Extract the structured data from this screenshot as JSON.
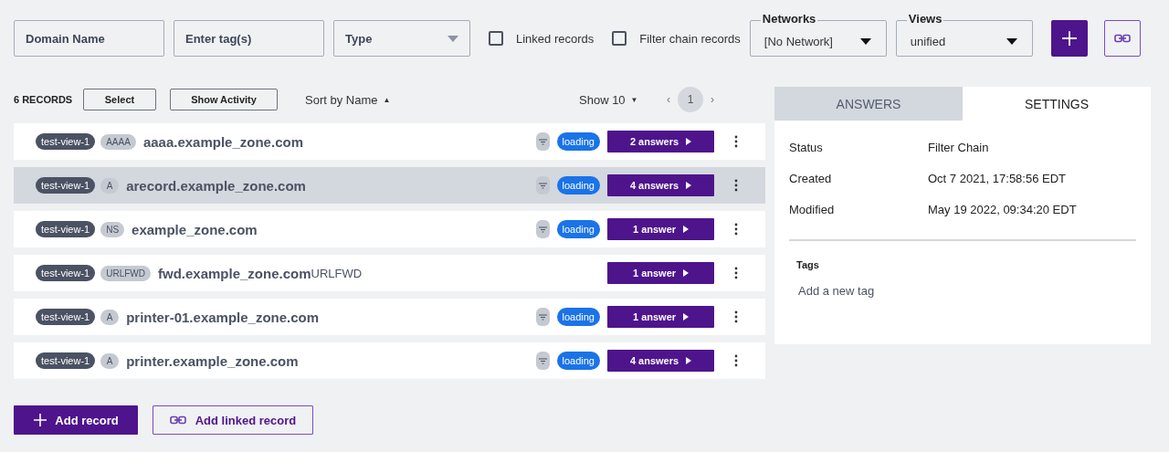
{
  "filters": {
    "domain_placeholder": "Domain Name",
    "tags_placeholder": "Enter tag(s)",
    "type_placeholder": "Type",
    "checkboxes": [
      {
        "label": "Linked records",
        "checked": false
      },
      {
        "label": "Filter chain records",
        "checked": false
      }
    ],
    "selects": [
      {
        "label": "Networks",
        "value": "[No Network]"
      },
      {
        "label": "Views",
        "value": "unified"
      }
    ]
  },
  "toolbar": {
    "count": "6 RECORDS",
    "buttons": [
      "Select",
      "Show Activity"
    ],
    "sort": "Sort by Name",
    "sort_arrow": "▲",
    "page_size": "Show 10",
    "page_size_arrow": "▼",
    "prev": "‹",
    "page": "1",
    "next": "›"
  },
  "records": [
    {
      "view": "test-view-1",
      "type": "AAAA",
      "name": "aaaa.example_zone.com",
      "filtered": true,
      "status": "loading",
      "answers": "2 answers",
      "selected": false
    },
    {
      "view": "test-view-1",
      "type": "A",
      "name": "arecord.example_zone.com",
      "filtered": true,
      "status": "loading",
      "answers": "4 answers",
      "selected": true
    },
    {
      "view": "test-view-1",
      "type": "NS",
      "name": "example_zone.com",
      "filtered": true,
      "status": "loading",
      "answers": "1 answer",
      "selected": false
    },
    {
      "view": "test-view-1",
      "type": "URLFWD",
      "name": "fwd.example_zone.com",
      "suffix": "URLFWD",
      "filtered": false,
      "answers": "1 answer",
      "selected": false
    },
    {
      "view": "test-view-1",
      "type": "A",
      "name": "printer-01.example_zone.com",
      "filtered": true,
      "status": "loading",
      "answers": "1 answer",
      "selected": false
    },
    {
      "view": "test-view-1",
      "type": "A",
      "name": "printer.example_zone.com",
      "filtered": true,
      "status": "loading",
      "answers": "4 answers",
      "selected": false
    }
  ],
  "footer": {
    "add": "Add record",
    "add_linked": "Add linked record"
  },
  "panel": {
    "tabs": [
      {
        "label": "ANSWERS",
        "selected": false
      },
      {
        "label": "SETTINGS",
        "selected": true
      }
    ],
    "fields": [
      {
        "label": "Status",
        "value": "Filter Chain"
      },
      {
        "label": "Created",
        "value": "Oct 7 2021, 17:58:56 EDT"
      },
      {
        "label": "Modified",
        "value": "May 19 2022, 09:34:20 EDT"
      }
    ],
    "tags_title": "Tags",
    "tags_placeholder": "Add a new tag"
  }
}
